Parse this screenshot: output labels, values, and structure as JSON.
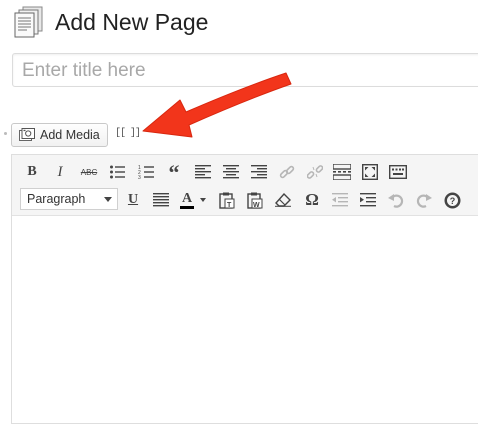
{
  "header": {
    "title": "Add New Page",
    "icon": "pages-icon"
  },
  "title_field": {
    "placeholder": "Enter title here",
    "value": ""
  },
  "media": {
    "add_media_label": "Add Media",
    "shortcode_label": "[[ ]]"
  },
  "toolbar": {
    "row1": [
      "bold",
      "italic",
      "strikethrough",
      "bullet-list",
      "numbered-list",
      "blockquote",
      "align-left",
      "align-center",
      "align-right",
      "insert-link",
      "remove-link",
      "insert-more",
      "fullscreen",
      "toolbar-toggle"
    ],
    "row2": [
      "format-select",
      "underline",
      "justify",
      "text-color",
      "paste-as-text",
      "paste-from-word",
      "clear-formatting",
      "special-character",
      "outdent",
      "indent",
      "undo",
      "redo",
      "help"
    ],
    "bold_label": "B",
    "italic_label": "I",
    "strike_label": "ABC",
    "quote_label": "“",
    "underline_label": "U",
    "color_label": "A",
    "omega_label": "Ω",
    "format_value": "Paragraph"
  },
  "editor": {
    "content": ""
  },
  "colors": {
    "arrow": "#f2351b",
    "toolbar_bg": "#f5f5f5",
    "text_color_swatch": "#000000"
  }
}
